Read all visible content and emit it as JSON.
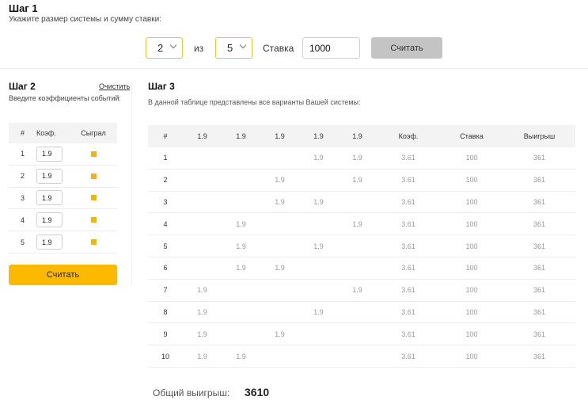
{
  "step1": {
    "title": "Шаг 1",
    "subtitle": "Укажите размер системы и сумму ставки:",
    "system_size": "2",
    "of_label": "из",
    "total_events": "5",
    "stake_label": "Ставка",
    "stake_value": "1000",
    "calc_label": "Считать"
  },
  "step2": {
    "title": "Шаг 2",
    "clear_label": "Очистить",
    "subtitle": "Введите коэффициенты событий:",
    "headers": {
      "num": "#",
      "coef": "Коэф.",
      "played": "Сыграл"
    },
    "rows": [
      {
        "num": "1",
        "coef": "1.9"
      },
      {
        "num": "2",
        "coef": "1.9"
      },
      {
        "num": "3",
        "coef": "1.9"
      },
      {
        "num": "4",
        "coef": "1.9"
      },
      {
        "num": "5",
        "coef": "1.9"
      }
    ],
    "calc_label": "Считать",
    "played_color": "#f7b500"
  },
  "step3": {
    "title": "Шаг 3",
    "subtitle": "В данной таблице представлены все варианты Вашей системы:",
    "headers": {
      "num": "#",
      "e1": "1.9",
      "e2": "1.9",
      "e3": "1.9",
      "e4": "1.9",
      "e5": "1.9",
      "coef": "Коэф.",
      "stake": "Ставка",
      "win": "Выигрыш"
    },
    "rows": [
      {
        "num": "1",
        "e1": "",
        "e2": "",
        "e3": "",
        "e4": "1.9",
        "e5": "1.9",
        "coef": "3.61",
        "stake": "100",
        "win": "361"
      },
      {
        "num": "2",
        "e1": "",
        "e2": "",
        "e3": "1.9",
        "e4": "",
        "e5": "1.9",
        "coef": "3.61",
        "stake": "100",
        "win": "361"
      },
      {
        "num": "3",
        "e1": "",
        "e2": "",
        "e3": "1.9",
        "e4": "1.9",
        "e5": "",
        "coef": "3.61",
        "stake": "100",
        "win": "361"
      },
      {
        "num": "4",
        "e1": "",
        "e2": "1.9",
        "e3": "",
        "e4": "",
        "e5": "1.9",
        "coef": "3.61",
        "stake": "100",
        "win": "361"
      },
      {
        "num": "5",
        "e1": "",
        "e2": "1.9",
        "e3": "",
        "e4": "1.9",
        "e5": "",
        "coef": "3.61",
        "stake": "100",
        "win": "361"
      },
      {
        "num": "6",
        "e1": "",
        "e2": "1.9",
        "e3": "1.9",
        "e4": "",
        "e5": "",
        "coef": "3.61",
        "stake": "100",
        "win": "361"
      },
      {
        "num": "7",
        "e1": "1.9",
        "e2": "",
        "e3": "",
        "e4": "",
        "e5": "1.9",
        "coef": "3.61",
        "stake": "100",
        "win": "361"
      },
      {
        "num": "8",
        "e1": "1.9",
        "e2": "",
        "e3": "",
        "e4": "1.9",
        "e5": "",
        "coef": "3.61",
        "stake": "100",
        "win": "361"
      },
      {
        "num": "9",
        "e1": "1.9",
        "e2": "",
        "e3": "1.9",
        "e4": "",
        "e5": "",
        "coef": "3.61",
        "stake": "100",
        "win": "361"
      },
      {
        "num": "10",
        "e1": "1.9",
        "e2": "1.9",
        "e3": "",
        "e4": "",
        "e5": "",
        "coef": "3.61",
        "stake": "100",
        "win": "361"
      }
    ]
  },
  "total": {
    "label": "Общий выигрыш:",
    "value": "3610"
  }
}
